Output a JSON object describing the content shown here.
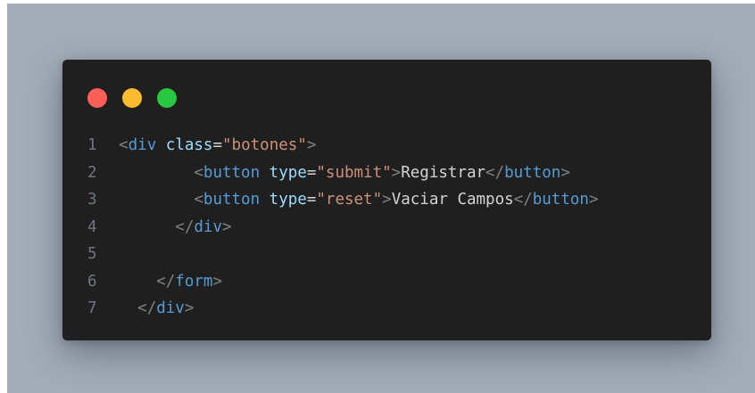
{
  "colors": {
    "backdrop": "#a3adb8",
    "editor_bg": "#1f1f1f",
    "dot_red": "#fe5f57",
    "dot_yellow": "#febc2e",
    "dot_green": "#28c840",
    "line_number": "#6e7681",
    "punctuation": "#808080",
    "tag": "#569cd6",
    "attribute": "#9cdcfe",
    "string": "#ce9178",
    "text": "#d4d4d4"
  },
  "window": {
    "controls": [
      "close-dot",
      "minimize-dot",
      "zoom-dot"
    ]
  },
  "code": {
    "lines": [
      {
        "number": "1",
        "indent": "  ",
        "tokens": [
          {
            "t": "punc",
            "v": "<"
          },
          {
            "t": "tag",
            "v": "div"
          },
          {
            "t": "text",
            "v": " "
          },
          {
            "t": "attr",
            "v": "class"
          },
          {
            "t": "eq",
            "v": "="
          },
          {
            "t": "str",
            "v": "\"botones\""
          },
          {
            "t": "punc",
            "v": ">"
          }
        ]
      },
      {
        "number": "2",
        "indent": "          ",
        "tokens": [
          {
            "t": "punc",
            "v": "<"
          },
          {
            "t": "tag",
            "v": "button"
          },
          {
            "t": "text",
            "v": " "
          },
          {
            "t": "attr",
            "v": "type"
          },
          {
            "t": "eq",
            "v": "="
          },
          {
            "t": "str",
            "v": "\"submit\""
          },
          {
            "t": "punc",
            "v": ">"
          },
          {
            "t": "text",
            "v": "Registrar"
          },
          {
            "t": "punc",
            "v": "</"
          },
          {
            "t": "tag",
            "v": "button"
          },
          {
            "t": "punc",
            "v": ">"
          }
        ]
      },
      {
        "number": "3",
        "indent": "          ",
        "tokens": [
          {
            "t": "punc",
            "v": "<"
          },
          {
            "t": "tag",
            "v": "button"
          },
          {
            "t": "text",
            "v": " "
          },
          {
            "t": "attr",
            "v": "type"
          },
          {
            "t": "eq",
            "v": "="
          },
          {
            "t": "str",
            "v": "\"reset\""
          },
          {
            "t": "punc",
            "v": ">"
          },
          {
            "t": "text",
            "v": "Vaciar Campos"
          },
          {
            "t": "punc",
            "v": "</"
          },
          {
            "t": "tag",
            "v": "button"
          },
          {
            "t": "punc",
            "v": ">"
          }
        ]
      },
      {
        "number": "4",
        "indent": "        ",
        "tokens": [
          {
            "t": "punc",
            "v": "</"
          },
          {
            "t": "tag",
            "v": "div"
          },
          {
            "t": "punc",
            "v": ">"
          }
        ]
      },
      {
        "number": "5",
        "indent": "",
        "tokens": []
      },
      {
        "number": "6",
        "indent": "      ",
        "tokens": [
          {
            "t": "punc",
            "v": "</"
          },
          {
            "t": "tag",
            "v": "form"
          },
          {
            "t": "punc",
            "v": ">"
          }
        ]
      },
      {
        "number": "7",
        "indent": "    ",
        "tokens": [
          {
            "t": "punc",
            "v": "</"
          },
          {
            "t": "tag",
            "v": "div"
          },
          {
            "t": "punc",
            "v": ">"
          }
        ]
      }
    ]
  }
}
